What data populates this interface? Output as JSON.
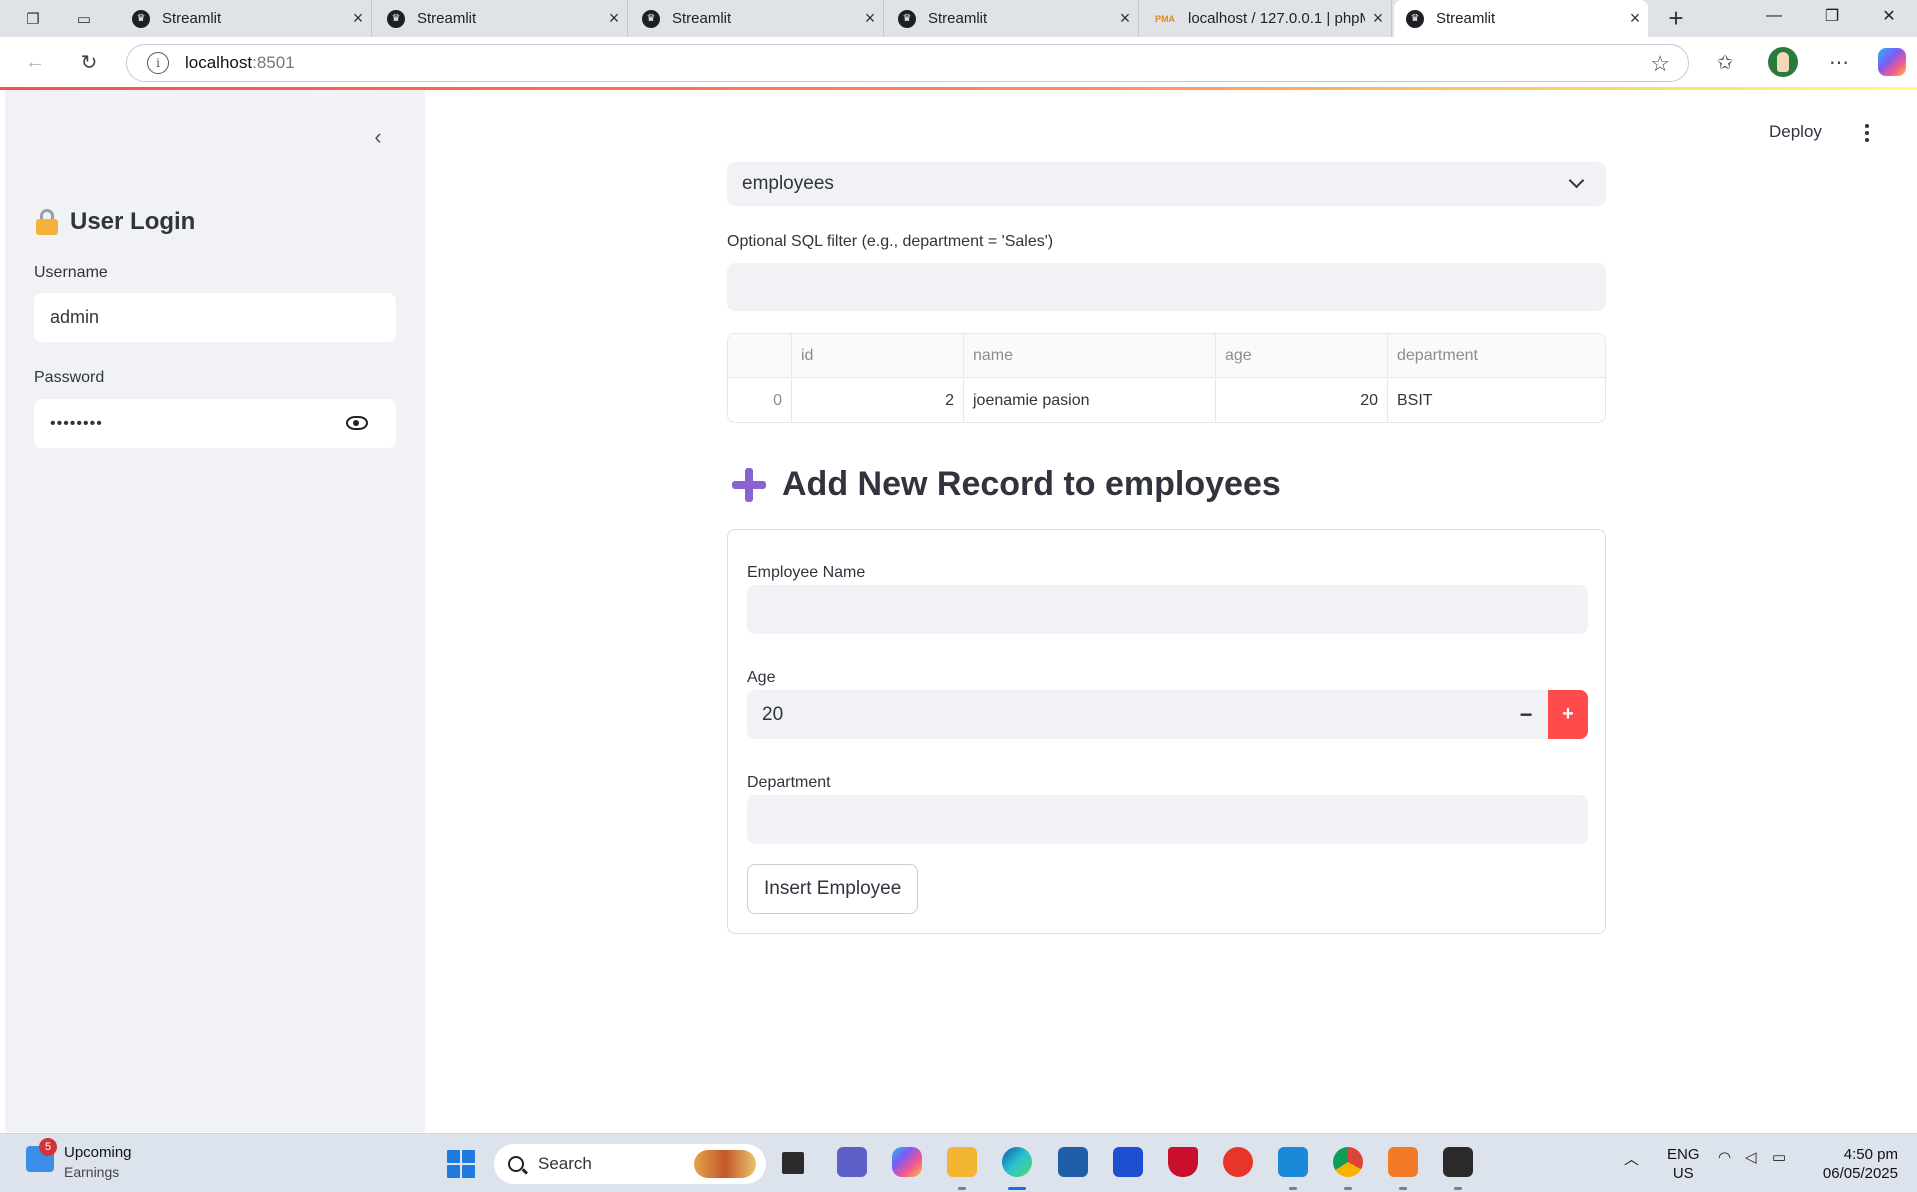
{
  "browser": {
    "tabs": [
      {
        "title": "Streamlit",
        "favicon": "streamlit-crown-icon"
      },
      {
        "title": "Streamlit",
        "favicon": "streamlit-crown-icon"
      },
      {
        "title": "Streamlit",
        "favicon": "streamlit-crown-icon"
      },
      {
        "title": "Streamlit",
        "favicon": "streamlit-crown-icon"
      },
      {
        "title": "localhost / 127.0.0.1 | phpM",
        "favicon": "phpmyadmin-icon"
      },
      {
        "title": "Streamlit",
        "favicon": "streamlit-crown-icon",
        "active": true
      }
    ],
    "url_host": "localhost",
    "url_port": ":8501"
  },
  "sidebar": {
    "title": "User Login",
    "title_icon": "lock-icon",
    "username_label": "Username",
    "username_value": "admin",
    "password_label": "Password",
    "password_masked": "••••••••"
  },
  "header": {
    "deploy_label": "Deploy"
  },
  "table_select": {
    "selected": "employees"
  },
  "filter": {
    "label": "Optional SQL filter (e.g., department = 'Sales')",
    "value": ""
  },
  "grid": {
    "columns": [
      "",
      "id",
      "name",
      "age",
      "department"
    ],
    "rows": [
      [
        "0",
        "2",
        "joenamie pasion",
        "20",
        "BSIT"
      ]
    ]
  },
  "form": {
    "heading": "Add New Record to employees",
    "heading_icon": "plus-icon",
    "name_label": "Employee Name",
    "name_value": "",
    "age_label": "Age",
    "age_value": "20",
    "minus_symbol": "−",
    "plus_symbol": "+",
    "department_label": "Department",
    "department_value": "",
    "submit_label": "Insert Employee"
  },
  "taskbar": {
    "widget_badge": "5",
    "widget_title": "Upcoming",
    "widget_subtitle": "Earnings",
    "search_label": "Search",
    "lang_line1": "ENG",
    "lang_line2": "US",
    "time": "4:50 pm",
    "date": "06/05/2025"
  },
  "colors": {
    "accent": "#ff4b4b",
    "sidebar_bg": "#f0f2f6",
    "text": "#31333f",
    "heading_icon": "#8a63d2"
  }
}
